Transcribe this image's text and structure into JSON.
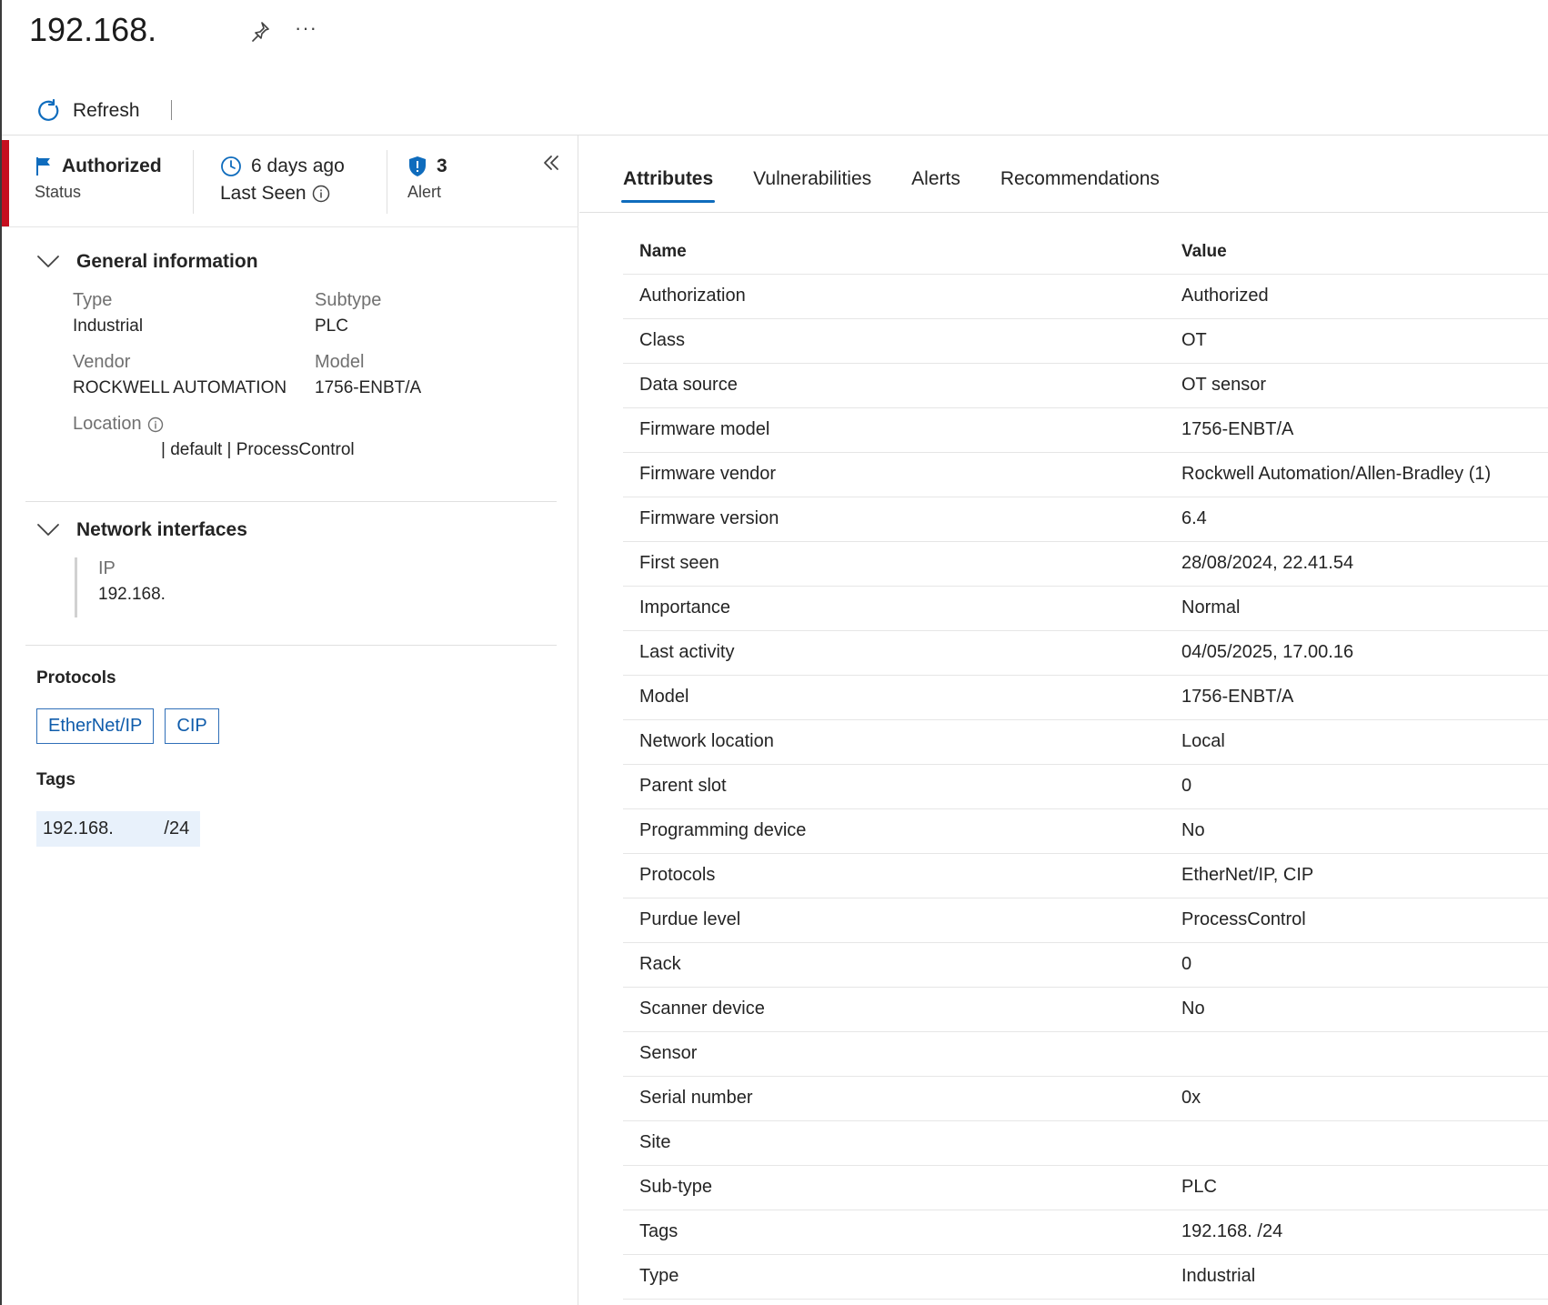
{
  "header": {
    "title": "192.168.",
    "pin_icon": "pin-icon",
    "more_label": "···"
  },
  "toolbar": {
    "refresh_label": "Refresh"
  },
  "summary": {
    "status_value": "Authorized",
    "status_label": "Status",
    "last_seen_value": "6 days ago",
    "last_seen_label": "Last Seen",
    "alert_count": "3",
    "alert_label": "Alert",
    "colors": {
      "status_strip": "#c50f1f",
      "accent": "#0f6cbd"
    }
  },
  "general": {
    "title": "General information",
    "type_label": "Type",
    "type_value": "Industrial",
    "subtype_label": "Subtype",
    "subtype_value": "PLC",
    "vendor_label": "Vendor",
    "vendor_value": "ROCKWELL AUTOMATION",
    "model_label": "Model",
    "model_value": "1756-ENBT/A",
    "location_label": "Location",
    "location_value": "| default | ProcessControl"
  },
  "network": {
    "title": "Network interfaces",
    "ip_label": "IP",
    "ip_value": "192.168."
  },
  "protocols": {
    "title": "Protocols",
    "items": [
      "EtherNet/IP",
      "CIP"
    ]
  },
  "tags": {
    "title": "Tags",
    "value": "192.168.          /24"
  },
  "tabs": [
    "Attributes",
    "Vulnerabilities",
    "Alerts",
    "Recommendations"
  ],
  "table": {
    "columns": [
      "Name",
      "Value"
    ],
    "rows": [
      [
        "Authorization",
        "Authorized"
      ],
      [
        "Class",
        "OT"
      ],
      [
        "Data source",
        "OT sensor"
      ],
      [
        "Firmware model",
        "1756-ENBT/A"
      ],
      [
        "Firmware vendor",
        "Rockwell Automation/Allen-Bradley (1)"
      ],
      [
        "Firmware version",
        "6.4"
      ],
      [
        "First seen",
        "28/08/2024, 22.41.54"
      ],
      [
        "Importance",
        "Normal"
      ],
      [
        "Last activity",
        "04/05/2025, 17.00.16"
      ],
      [
        "Model",
        "1756-ENBT/A"
      ],
      [
        "Network location",
        "Local"
      ],
      [
        "Parent slot",
        "0"
      ],
      [
        "Programming device",
        "No"
      ],
      [
        "Protocols",
        "EtherNet/IP, CIP"
      ],
      [
        "Purdue level",
        "ProcessControl"
      ],
      [
        "Rack",
        "0"
      ],
      [
        "Scanner device",
        "No"
      ],
      [
        "Sensor",
        ""
      ],
      [
        "Serial number",
        "0x"
      ],
      [
        "Site",
        ""
      ],
      [
        "Sub-type",
        "PLC"
      ],
      [
        "Tags",
        "192.168.       /24"
      ],
      [
        "Type",
        "Industrial"
      ]
    ]
  }
}
